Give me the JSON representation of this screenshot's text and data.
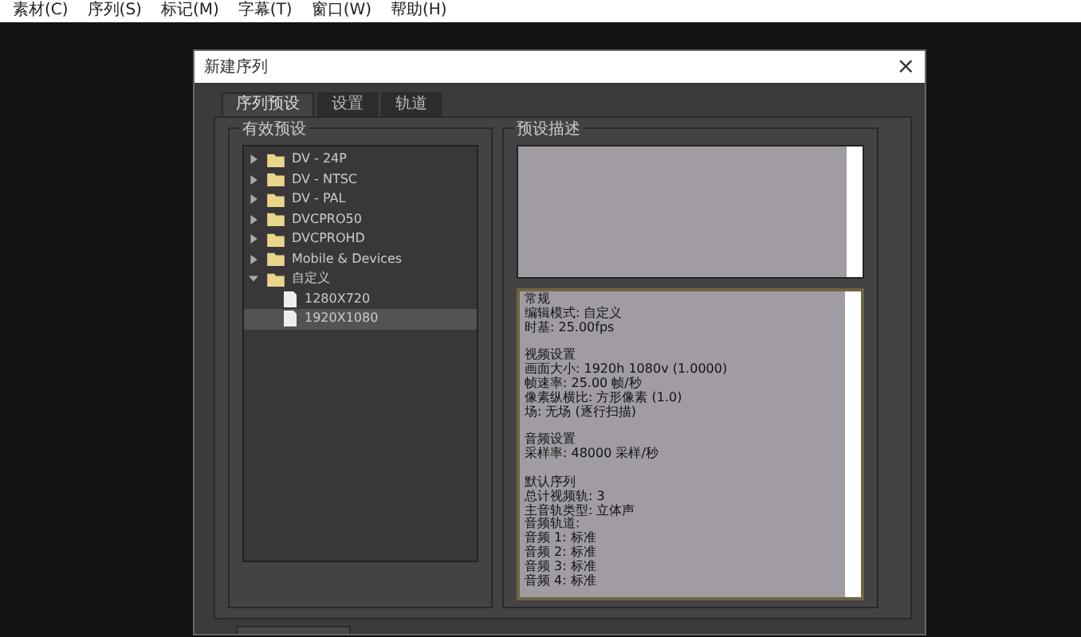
{
  "menu_bar": [
    "素材(C)",
    "序列(S)",
    "标记(M)",
    "字幕(T)",
    "窗口(W)",
    "帮助(H)"
  ],
  "dialog": {
    "title": "新建序列",
    "close": "×",
    "tabs": [
      {
        "label": "序列预设",
        "selected": true
      },
      {
        "label": "设置",
        "selected": false
      },
      {
        "label": "轨道",
        "selected": false
      }
    ],
    "presets": {
      "label": "有效预设",
      "tree": [
        {
          "label": "DV - 24P",
          "expanded": false,
          "selected": false
        },
        {
          "label": "DV - NTSC",
          "expanded": false,
          "selected": false
        },
        {
          "label": "DV - PAL",
          "expanded": false,
          "selected": false
        },
        {
          "label": "DVCPRO50",
          "expanded": false,
          "selected": false
        },
        {
          "label": "DVCPROHD",
          "expanded": false,
          "selected": false
        },
        {
          "label": "Mobile & Devices",
          "expanded": false,
          "selected": false
        },
        {
          "label": "自定义",
          "expanded": true,
          "selected": false,
          "children": [
            {
              "label": "1280X720",
              "selected": false
            },
            {
              "label": "1920X1080",
              "selected": true
            }
          ]
        }
      ]
    },
    "description": {
      "label": "预设描述",
      "sections": [
        {
          "heading": "常规",
          "lines": [
            "编辑模式: 自定义",
            "时基: 25.00fps"
          ]
        },
        {
          "heading": "视频设置",
          "lines": [
            "画面大小: 1920h 1080v (1.0000)",
            "帧速率: 25.00 帧/秒",
            "像素纵横比: 方形像素 (1.0)",
            "场: 无场 (逐行扫描)"
          ]
        },
        {
          "heading": "音频设置",
          "lines": [
            "采样率: 48000 采样/秒"
          ]
        },
        {
          "heading": "默认序列",
          "lines": [
            "总计视频轨: 3",
            "主音轨类型: 立体声",
            "音频轨道:",
            "音频 1: 标准",
            "音频 2: 标准",
            "音频 3: 标准",
            "音频 4: 标准"
          ]
        }
      ]
    }
  }
}
